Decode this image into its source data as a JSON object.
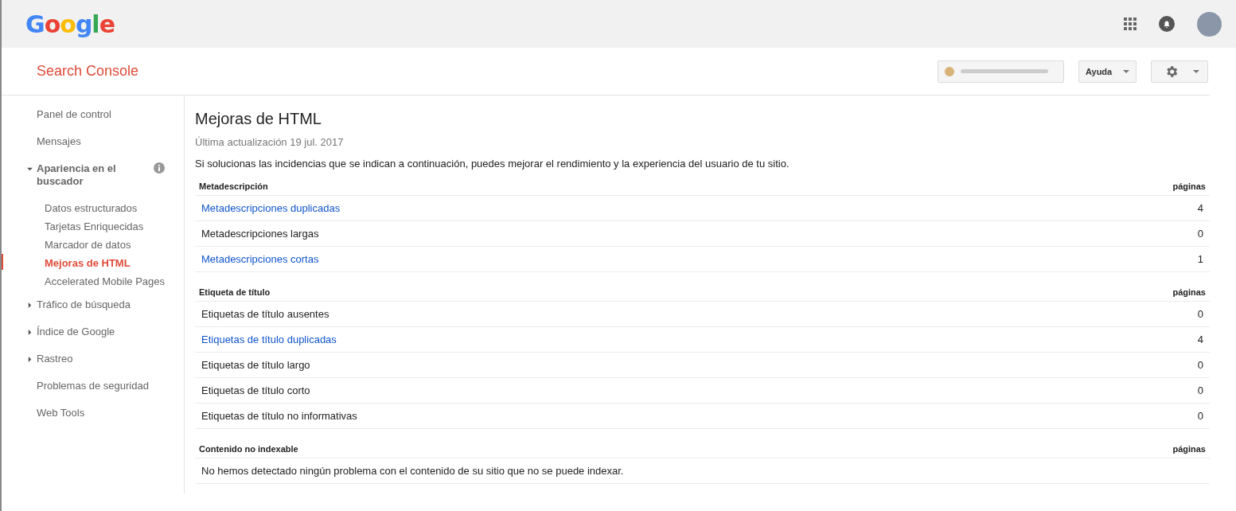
{
  "header": {
    "logo": "Google"
  },
  "subheader": {
    "title": "Search Console",
    "help_button": "Ayuda"
  },
  "sidebar": {
    "items": [
      {
        "label": "Panel de control",
        "kind": "link",
        "selected": false,
        "info": false
      },
      {
        "label": "Mensajes",
        "kind": "link",
        "selected": false,
        "info": false
      },
      {
        "label": "Apariencia en el buscador",
        "kind": "group",
        "expanded": true,
        "selected": false,
        "info": true,
        "children": [
          {
            "label": "Datos estructurados",
            "selected": false
          },
          {
            "label": "Tarjetas Enriquecidas",
            "selected": false
          },
          {
            "label": "Marcador de datos",
            "selected": false
          },
          {
            "label": "Mejoras de HTML",
            "selected": true
          },
          {
            "label": "Accelerated Mobile Pages",
            "selected": false
          }
        ]
      },
      {
        "label": "Tráfico de búsqueda",
        "kind": "group",
        "expanded": false,
        "selected": false,
        "info": false
      },
      {
        "label": "Índice de Google",
        "kind": "group",
        "expanded": false,
        "selected": false,
        "info": false
      },
      {
        "label": "Rastreo",
        "kind": "group",
        "expanded": false,
        "selected": false,
        "info": false
      },
      {
        "label": "Problemas de seguridad",
        "kind": "link",
        "selected": false,
        "info": false
      },
      {
        "label": "Web Tools",
        "kind": "link",
        "selected": false,
        "info": false
      }
    ]
  },
  "main": {
    "title": "Mejoras de HTML",
    "updated": "Última actualización 19 jul. 2017",
    "intro": "Si solucionas las incidencias que se indican a continuación, puedes mejorar el rendimiento y la experiencia del usuario de tu sitio.",
    "sections": [
      {
        "heading": "Metadescripción",
        "count_heading": "páginas",
        "rows": [
          {
            "label": "Metadescripciones duplicadas",
            "count": "4",
            "kind": "link"
          },
          {
            "label": "Metadescripciones largas",
            "count": "0",
            "kind": "text"
          },
          {
            "label": "Metadescripciones cortas",
            "count": "1",
            "kind": "link"
          }
        ]
      },
      {
        "heading": "Etiqueta de título",
        "count_heading": "páginas",
        "rows": [
          {
            "label": "Etiquetas de título ausentes",
            "count": "0",
            "kind": "text"
          },
          {
            "label": "Etiquetas de título duplicadas",
            "count": "4",
            "kind": "link"
          },
          {
            "label": "Etiquetas de título largo",
            "count": "0",
            "kind": "text"
          },
          {
            "label": "Etiquetas de título corto",
            "count": "0",
            "kind": "text"
          },
          {
            "label": "Etiquetas de título no informativas",
            "count": "0",
            "kind": "text"
          }
        ]
      },
      {
        "heading": "Contenido no indexable",
        "count_heading": "páginas",
        "rows": [
          {
            "label": "No hemos detectado ningún problema con el contenido de su sitio que no se puede indexar.",
            "kind": "message"
          }
        ]
      }
    ]
  }
}
